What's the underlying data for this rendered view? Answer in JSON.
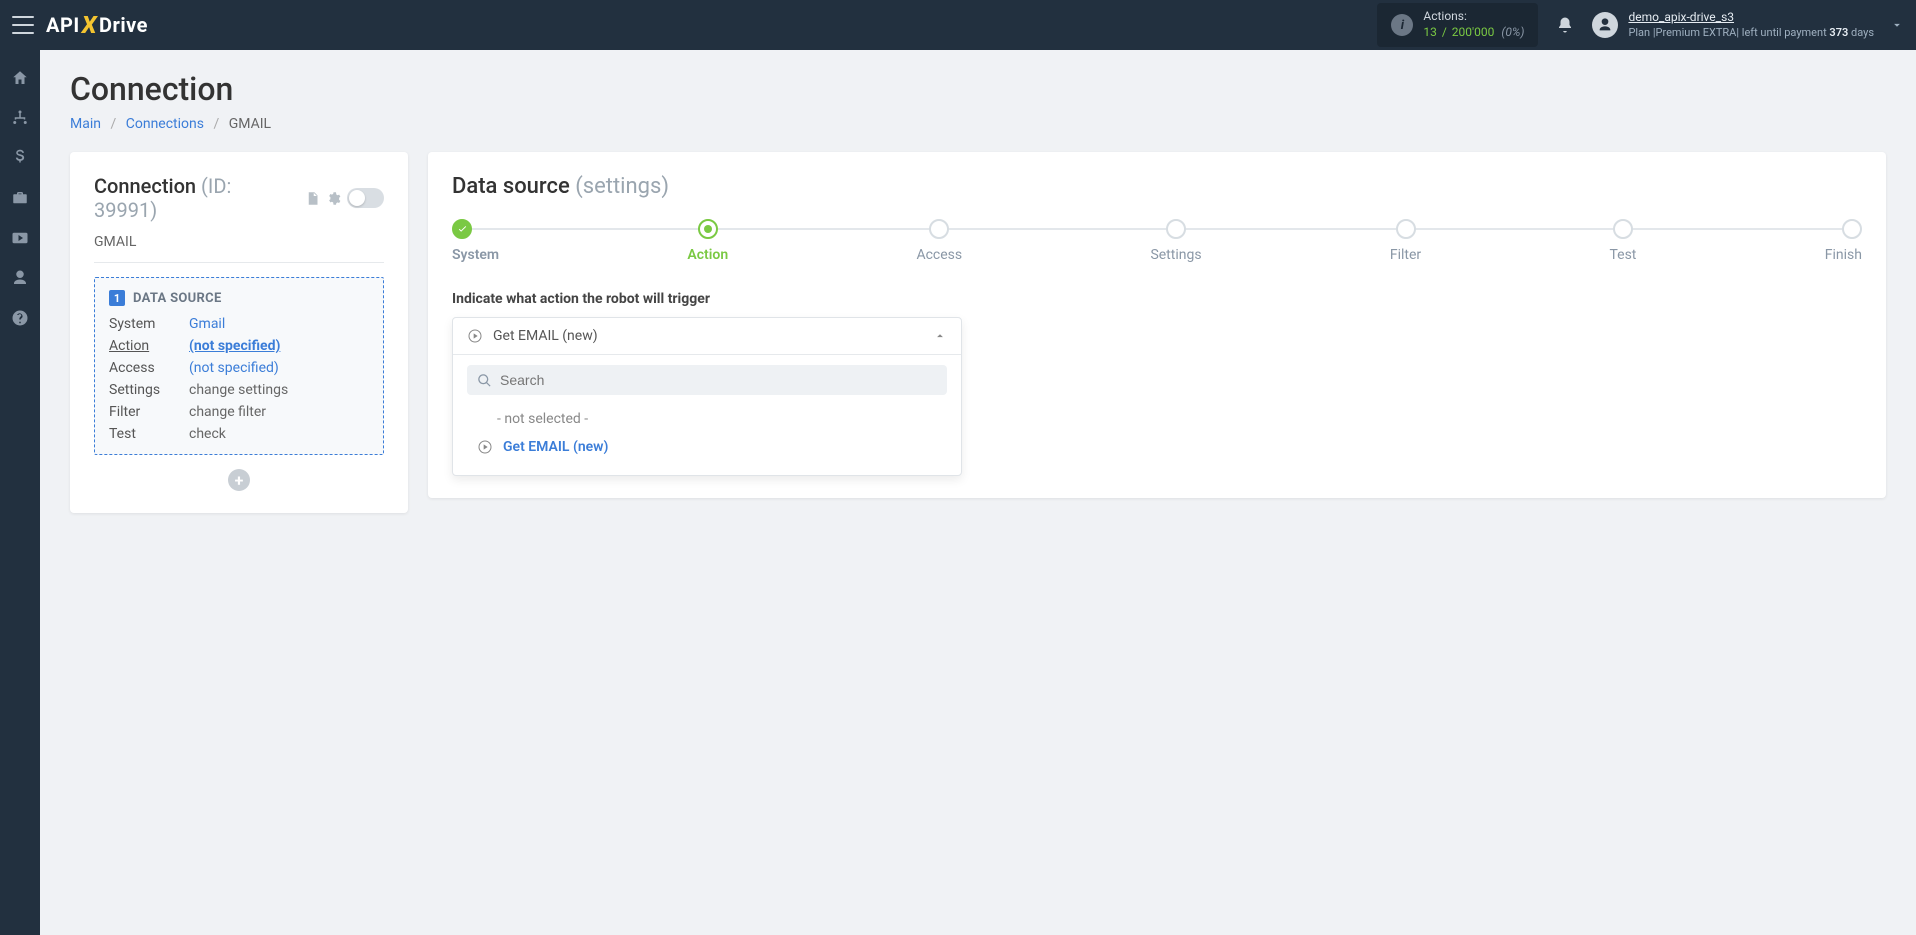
{
  "header": {
    "logo": {
      "part1": "API",
      "part2": "X",
      "part3": "Drive"
    },
    "actions": {
      "label": "Actions:",
      "used": "13",
      "total": "200'000",
      "percent": "(0%)"
    },
    "user": {
      "name": "demo_apix-drive_s3",
      "plan_prefix": "Plan |",
      "plan_name": "Premium EXTRA",
      "plan_sep": "|",
      "plan_tail_pre": " left until payment ",
      "plan_days": "373",
      "plan_tail_post": " days"
    }
  },
  "page": {
    "title": "Connection",
    "breadcrumb": {
      "main": "Main",
      "connections": "Connections",
      "current": "GMAIL"
    }
  },
  "connection_card": {
    "title": "Connection",
    "id_label": "(ID: 39991)",
    "subtitle": "GMAIL",
    "ds_badge": "1",
    "ds_title": "DATA SOURCE",
    "rows": {
      "system": {
        "k": "System",
        "v": "Gmail"
      },
      "action": {
        "k": "Action",
        "v": "(not specified)"
      },
      "access": {
        "k": "Access",
        "v": "(not specified)"
      },
      "settings": {
        "k": "Settings",
        "v": "change settings"
      },
      "filter": {
        "k": "Filter",
        "v": "change filter"
      },
      "test": {
        "k": "Test",
        "v": "check"
      }
    },
    "add": "+"
  },
  "right": {
    "title": "Data source",
    "title_muted": "(settings)",
    "steps": [
      "System",
      "Action",
      "Access",
      "Settings",
      "Filter",
      "Test",
      "Finish"
    ],
    "field_label": "Indicate what action the robot will trigger",
    "dropdown": {
      "selected": "Get EMAIL (new)",
      "search_placeholder": "Search",
      "not_selected": "- not selected -",
      "option1": "Get EMAIL (new)"
    }
  }
}
